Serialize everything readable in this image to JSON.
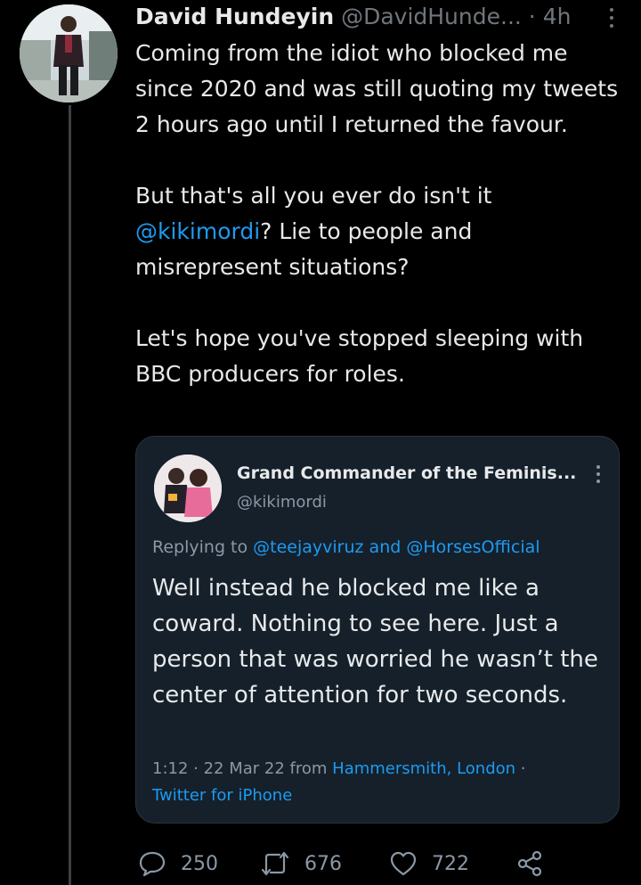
{
  "tweet": {
    "author_name": "David Hundeyin",
    "author_handle": "@DavidHunde...",
    "separator": "·",
    "time": "4h",
    "paragraphs": [
      {
        "text": "Coming from the idiot who blocked me since 2020 and was still quoting my tweets 2 hours ago until I returned the favour."
      },
      {
        "before": "But that's all you ever do isn't it ",
        "mention": "@kikimordi",
        "after": "? Lie to people and misrepresent situations?"
      },
      {
        "text": "Let's hope you've stopped sleeping with BBC producers for roles."
      }
    ]
  },
  "quoted": {
    "name": "Grand Commander of the Feminis...",
    "handle": "@kikimordi",
    "reply_prefix": "Replying to ",
    "reply_user1": "@teejayviruz",
    "reply_and": " and ",
    "reply_user2": "@HorsesOfficial",
    "text": "Well instead he blocked me like a coward. Nothing to see here. Just a person that was worried he wasn’t the center of attention for two seconds.",
    "time": "1:12 · 22 Mar 22",
    "from_label": " from ",
    "location": "Hammersmith, London",
    "dot": " · ",
    "client": "Twitter for iPhone"
  },
  "actions": {
    "replies": "250",
    "retweets": "676",
    "likes": "722"
  },
  "colors": {
    "background": "#000000",
    "text": "#e7e9ea",
    "secondary": "#71767b",
    "link": "#1d9bf0",
    "quote_bg": "#15202b"
  },
  "icons": [
    "reply-icon",
    "retweet-icon",
    "like-icon",
    "share-icon",
    "more-icon"
  ]
}
